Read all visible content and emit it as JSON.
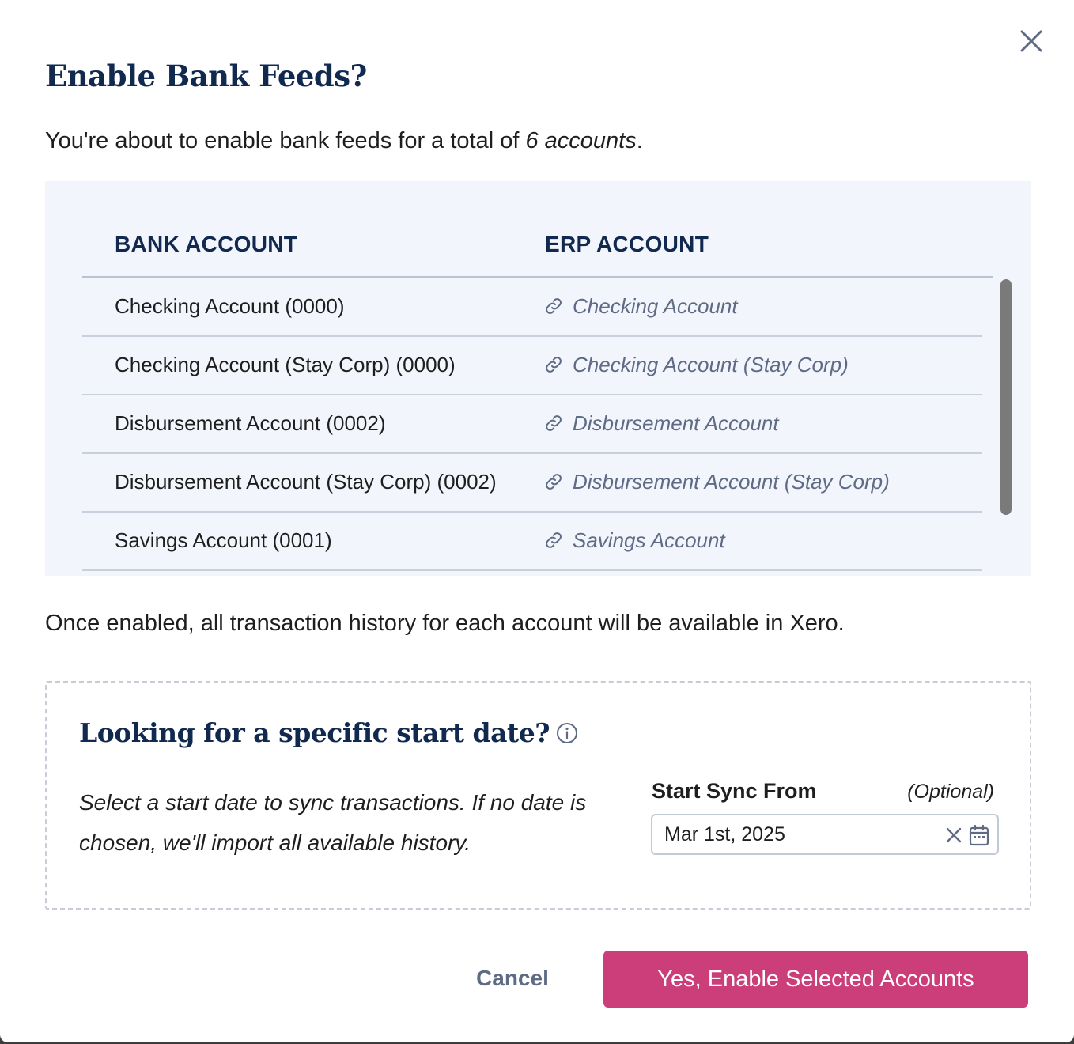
{
  "dialog": {
    "title": "Enable Bank Feeds?",
    "intro_prefix": "You're about to enable bank feeds for a total of ",
    "intro_count": "6 accounts",
    "intro_suffix": ".",
    "close_icon": "close-icon"
  },
  "table": {
    "headers": {
      "bank": "BANK ACCOUNT",
      "erp": "ERP ACCOUNT"
    },
    "link_icon": "link-icon",
    "rows": [
      {
        "bank": "Checking Account (0000)",
        "erp": "Checking Account"
      },
      {
        "bank": "Checking Account (Stay Corp) (0000)",
        "erp": "Checking Account (Stay Corp)"
      },
      {
        "bank": "Disbursement Account (0002)",
        "erp": "Disbursement Account"
      },
      {
        "bank": "Disbursement Account (Stay Corp) (0002)",
        "erp": "Disbursement Account (Stay Corp)"
      },
      {
        "bank": "Savings Account (0001)",
        "erp": "Savings Account"
      }
    ]
  },
  "note": "Once enabled, all transaction history for each account will be available in Xero.",
  "start_date": {
    "title": "Looking for a specific start date?",
    "info_icon": "info-icon",
    "help_text": "Select a start date to sync transactions. If no date is chosen, we'll import all available history.",
    "field_label": "Start Sync From",
    "optional_label": "(Optional)",
    "value": "Mar 1st, 2025",
    "clear_icon": "close-icon",
    "calendar_icon": "calendar-icon"
  },
  "actions": {
    "cancel": "Cancel",
    "confirm": "Yes, Enable Selected Accounts"
  },
  "colors": {
    "heading": "#12294f",
    "accent": "#cc3e79",
    "table_bg": "#f3f5fc",
    "muted": "#5f6b84"
  }
}
